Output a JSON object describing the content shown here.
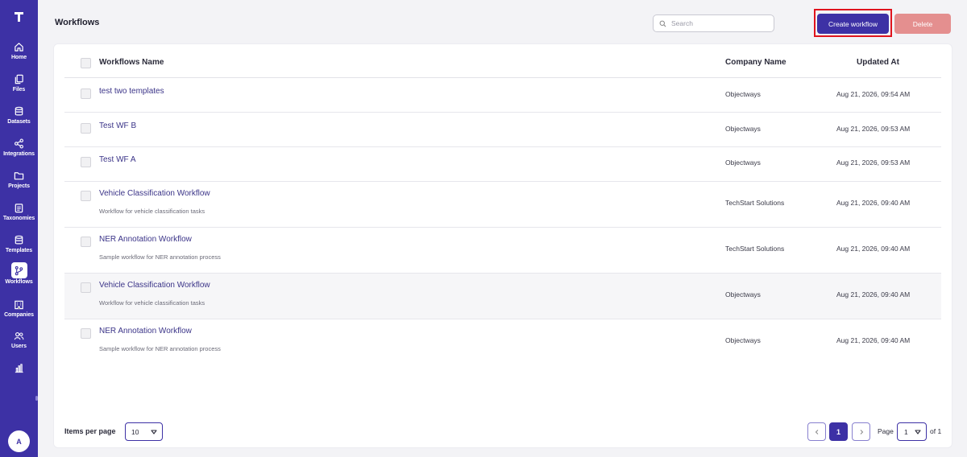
{
  "app": {
    "logo_letter": "T",
    "avatar_initial": "A"
  },
  "sidebar": {
    "items": [
      {
        "label": "Home",
        "icon": "home-icon"
      },
      {
        "label": "Files",
        "icon": "files-icon"
      },
      {
        "label": "Datasets",
        "icon": "database-icon"
      },
      {
        "label": "Integrations",
        "icon": "share-icon"
      },
      {
        "label": "Projects",
        "icon": "folder-icon"
      },
      {
        "label": "Taxonomies",
        "icon": "clipboard-icon"
      },
      {
        "label": "Templates",
        "icon": "database-icon"
      },
      {
        "label": "Workflows",
        "icon": "workflow-icon",
        "active": true
      },
      {
        "label": "Companies",
        "icon": "building-icon"
      },
      {
        "label": "Users",
        "icon": "users-icon"
      },
      {
        "label": "",
        "icon": "chart-icon"
      }
    ]
  },
  "header": {
    "title": "Workflows",
    "search_placeholder": "Search",
    "create_label": "Create workflow",
    "delete_label": "Delete"
  },
  "table": {
    "columns": {
      "name": "Workflows Name",
      "company": "Company Name",
      "updated": "Updated At"
    },
    "rows": [
      {
        "name": "test two templates",
        "description": "",
        "company": "Objectways",
        "updated": "Aug 21, 2026, 09:54 AM"
      },
      {
        "name": "Test WF B",
        "description": "",
        "company": "Objectways",
        "updated": "Aug 21, 2026, 09:53 AM"
      },
      {
        "name": "Test WF A",
        "description": "",
        "company": "Objectways",
        "updated": "Aug 21, 2026, 09:53 AM"
      },
      {
        "name": "Vehicle Classification Workflow",
        "description": "Workflow for vehicle classification tasks",
        "company": "TechStart Solutions",
        "updated": "Aug 21, 2026, 09:40 AM"
      },
      {
        "name": "NER Annotation Workflow",
        "description": "Sample workflow for NER annotation process",
        "company": "TechStart Solutions",
        "updated": "Aug 21, 2026, 09:40 AM"
      },
      {
        "name": "Vehicle Classification Workflow",
        "description": "Workflow for vehicle classification tasks",
        "company": "Objectways",
        "updated": "Aug 21, 2026, 09:40 AM"
      },
      {
        "name": "NER Annotation Workflow",
        "description": "Sample workflow for NER annotation process",
        "company": "Objectways",
        "updated": "Aug 21, 2026, 09:40 AM"
      }
    ]
  },
  "footer": {
    "items_per_page_label": "Items per page",
    "items_per_page_value": "10",
    "current_page": "1",
    "page_label": "Page",
    "page_select_value": "1",
    "of_label": "of 1"
  },
  "colors": {
    "brand": "#3d31a5",
    "delete": "#e48f8f",
    "highlight": "#e0141e"
  }
}
